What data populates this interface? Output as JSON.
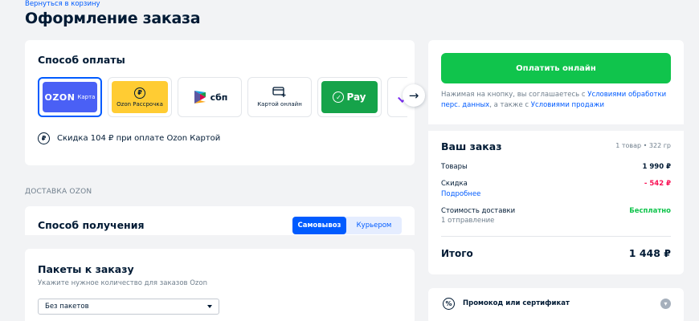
{
  "header": {
    "back_link": "Вернуться в корзину",
    "title": "Оформление заказа"
  },
  "payment": {
    "title": "Способ оплаты",
    "methods": [
      {
        "brand": "OZON",
        "label": "Карта",
        "selected": true,
        "color": "#4a60f5"
      },
      {
        "icon": "ruble-circle-icon",
        "label": "Ozon Рассрочка",
        "color": "#ffcc33"
      },
      {
        "icon": "sbp-logo-icon",
        "label": "сбп"
      },
      {
        "icon": "card-plus-icon",
        "label": "Картой онлайн"
      },
      {
        "icon": "check-circle-icon",
        "label": "Pay",
        "color": "#16a34a"
      }
    ],
    "discount_text": "Скидка 104 ₽ при оплате Ozon Картой"
  },
  "delivery": {
    "section_label": "ДОСТАВКА OZON",
    "receive_title": "Способ получения",
    "options": [
      "Самовывоз",
      "Курьером"
    ],
    "selected_option": "Самовывоз"
  },
  "bags": {
    "title": "Пакеты к заказу",
    "subtitle": "Укажите нужное количество для заказов Ozon",
    "selected": "Без пакетов"
  },
  "summary": {
    "pay_button": "Оплатить онлайн",
    "agree_prefix": "Нажимая на кнопку, вы соглашаетесь с ",
    "agree_link1": "Условиями обработки перс. данных",
    "agree_middle": ", а также с ",
    "agree_link2": "Условиями продажи",
    "order_title": "Ваш заказ",
    "order_meta": "1 товар • 322 гр",
    "goods_label": "Товары",
    "goods_value": "1 990 ₽",
    "discount_label": "Скидка",
    "discount_value": "- 542 ₽",
    "details_link": "Подробнее",
    "delivery_label": "Стоимость доставки",
    "delivery_value": "Бесплатно",
    "shipments": "1 отправление",
    "total_label": "Итого",
    "total_value": "1 448 ₽"
  },
  "promo": {
    "label": "Промокод или сертификат"
  },
  "colors": {
    "accent": "#005bff",
    "success": "#10c44c",
    "negative": "#f91155"
  }
}
